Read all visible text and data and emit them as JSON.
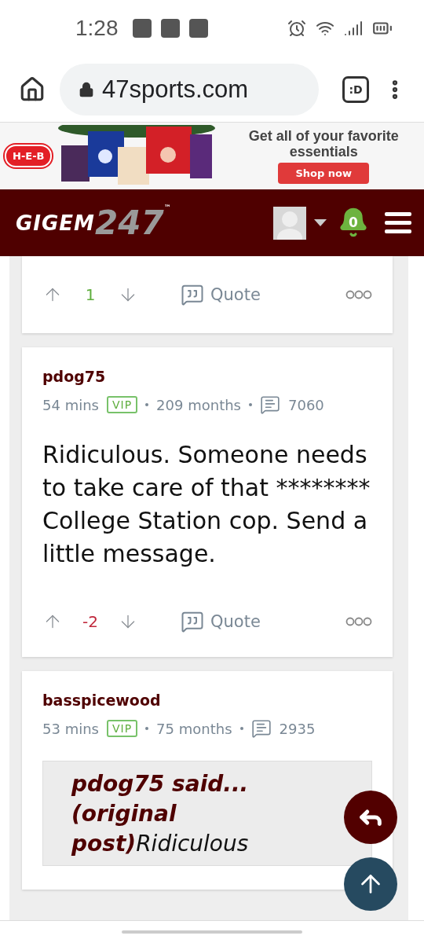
{
  "status_bar": {
    "time": "1:28"
  },
  "browser": {
    "url": "47sports.com",
    "tabs_label": ":D"
  },
  "ad": {
    "brand": "H-E-B",
    "headline": "Get all of your favorite essentials",
    "cta": "Shop now"
  },
  "site_header": {
    "logo_word": "GIGEM",
    "logo_number": "247",
    "logo_mark": "™",
    "notifications": "0"
  },
  "posts": [
    {
      "kind": "tail",
      "vote": {
        "score": "1",
        "color": "#5fae3e"
      },
      "quote_label": "Quote"
    },
    {
      "kind": "full",
      "author": "pdog75",
      "time": "54 mins",
      "badge": "VIP",
      "tenure": "209 months",
      "post_count": "7060",
      "body": "Ridiculous. Someone needs to take care of that ******** College Station cop. Send a little message.",
      "vote": {
        "score": "-2",
        "color": "#c0283c"
      },
      "quote_label": "Quote"
    },
    {
      "kind": "head",
      "author": "basspicewood",
      "time": "53 mins",
      "badge": "VIP",
      "tenure": "75 months",
      "post_count": "2935",
      "quote": "**pdog75 said... (original post)**Ridiculous"
    }
  ]
}
